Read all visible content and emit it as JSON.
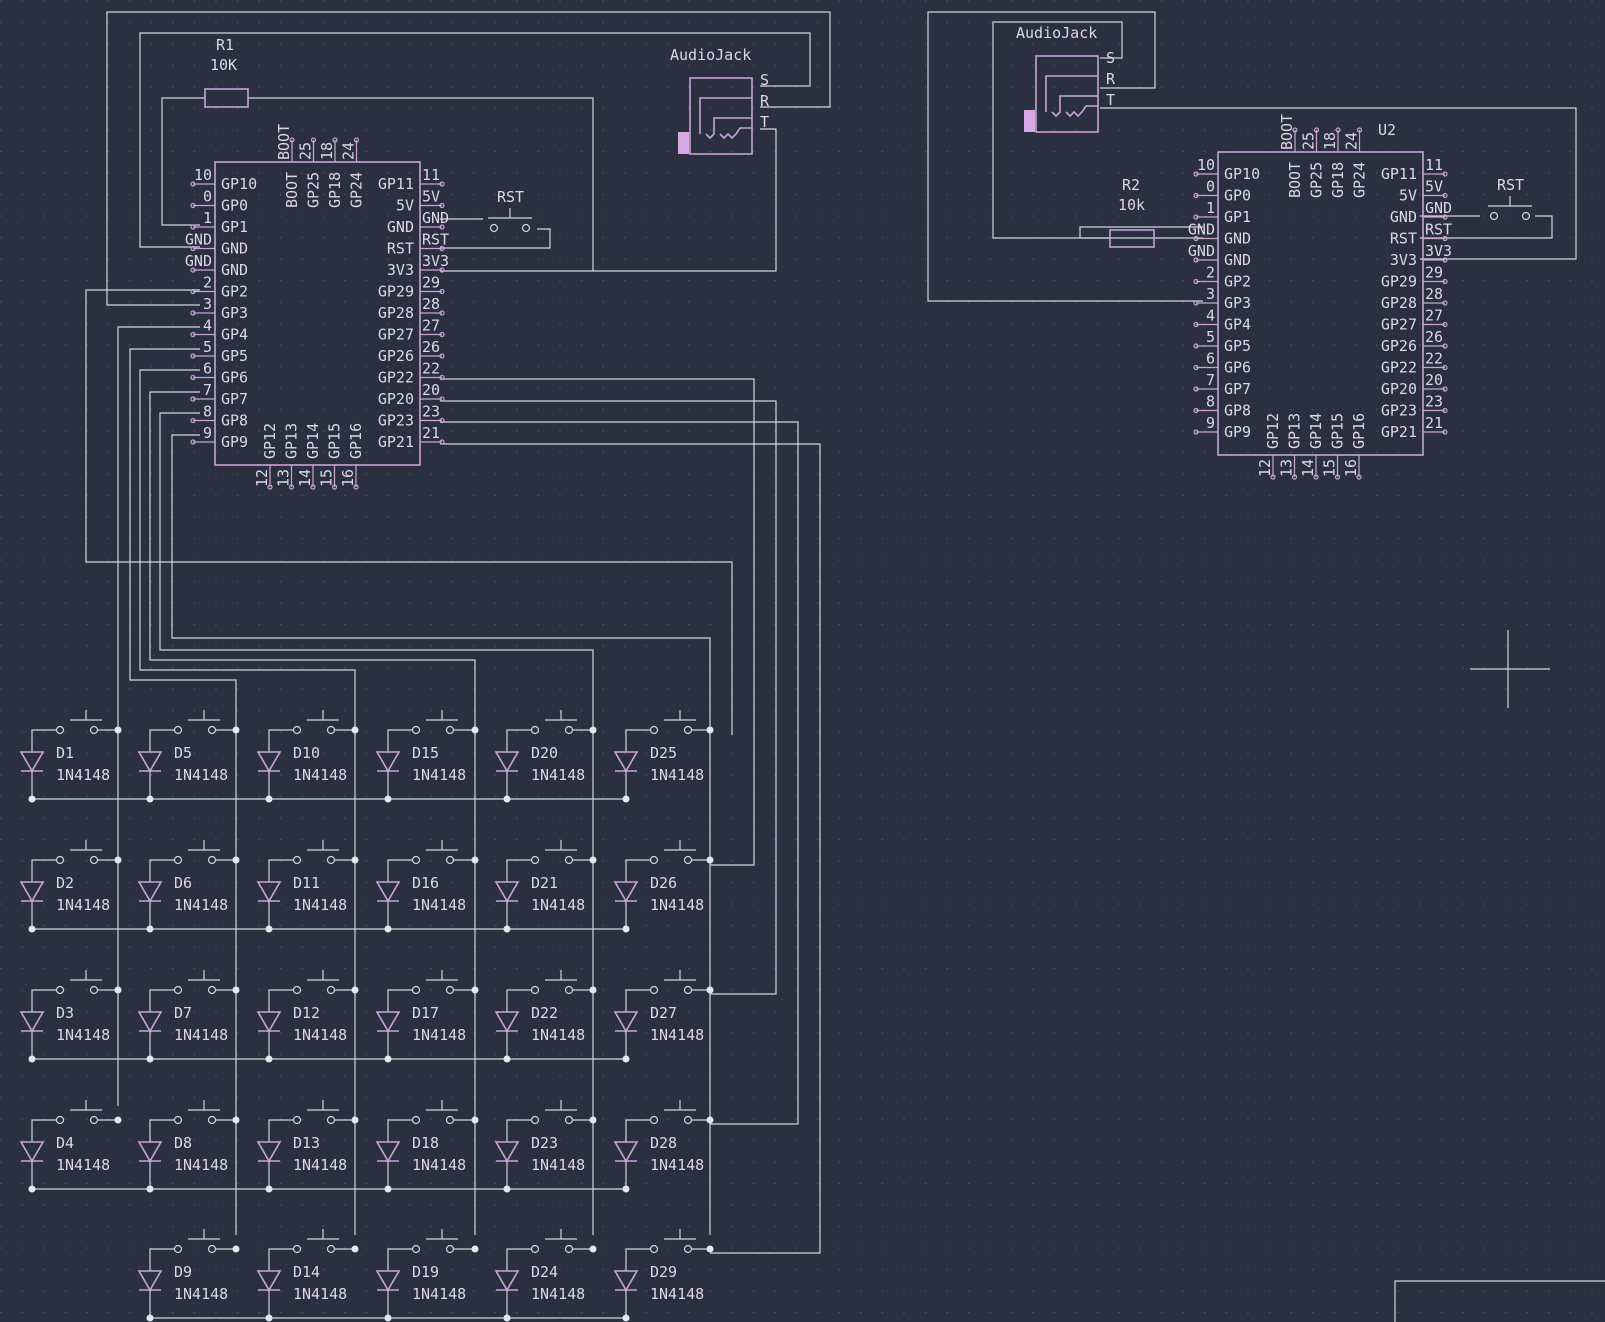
{
  "colors": {
    "background": "#2b3040",
    "wire": "#d2d2dc",
    "symbol": "#c9a4d4",
    "text": "#ddd6e6"
  },
  "r1": {
    "ref": "R1",
    "value": "10K"
  },
  "r2": {
    "ref": "R2",
    "value": "10k"
  },
  "u2": {
    "ref": "U2"
  },
  "audiojack": {
    "name": "AudioJack",
    "pins": [
      "S",
      "R",
      "T"
    ]
  },
  "rst_label": "RST",
  "mcu": {
    "left": [
      [
        "10",
        "GP10"
      ],
      [
        "0",
        "GP0"
      ],
      [
        "1",
        "GP1"
      ],
      [
        "GND",
        "GND"
      ],
      [
        "GND",
        "GND"
      ],
      [
        "2",
        "GP2"
      ],
      [
        "3",
        "GP3"
      ],
      [
        "4",
        "GP4"
      ],
      [
        "5",
        "GP5"
      ],
      [
        "6",
        "GP6"
      ],
      [
        "7",
        "GP7"
      ],
      [
        "8",
        "GP8"
      ],
      [
        "9",
        "GP9"
      ]
    ],
    "right": [
      [
        "11",
        "GP11"
      ],
      [
        "5V",
        "5V"
      ],
      [
        "GND",
        "GND"
      ],
      [
        "RST",
        "RST"
      ],
      [
        "3V3",
        "3V3"
      ],
      [
        "29",
        "GP29"
      ],
      [
        "28",
        "GP28"
      ],
      [
        "27",
        "GP27"
      ],
      [
        "26",
        "GP26"
      ],
      [
        "22",
        "GP22"
      ],
      [
        "20",
        "GP20"
      ],
      [
        "23",
        "GP23"
      ],
      [
        "21",
        "GP21"
      ]
    ],
    "top": [
      [
        "BOOT",
        "BOOT"
      ],
      [
        "25",
        "GP25"
      ],
      [
        "18",
        "GP18"
      ],
      [
        "24",
        "GP24"
      ]
    ],
    "bottom": [
      [
        "12",
        "GP12"
      ],
      [
        "13",
        "GP13"
      ],
      [
        "14",
        "GP14"
      ],
      [
        "15",
        "GP15"
      ],
      [
        "16",
        "GP16"
      ]
    ]
  },
  "diodes": [
    {
      "ref": "D1",
      "value": "1N4148",
      "col": 0,
      "row": 0
    },
    {
      "ref": "D2",
      "value": "1N4148",
      "col": 0,
      "row": 1
    },
    {
      "ref": "D3",
      "value": "1N4148",
      "col": 0,
      "row": 2
    },
    {
      "ref": "D4",
      "value": "1N4148",
      "col": 0,
      "row": 3
    },
    {
      "ref": "D5",
      "value": "1N4148",
      "col": 1,
      "row": 0
    },
    {
      "ref": "D6",
      "value": "1N4148",
      "col": 1,
      "row": 1
    },
    {
      "ref": "D7",
      "value": "1N4148",
      "col": 1,
      "row": 2
    },
    {
      "ref": "D8",
      "value": "1N4148",
      "col": 1,
      "row": 3
    },
    {
      "ref": "D9",
      "value": "1N4148",
      "col": 1,
      "row": 4
    },
    {
      "ref": "D10",
      "value": "1N4148",
      "col": 2,
      "row": 0
    },
    {
      "ref": "D11",
      "value": "1N4148",
      "col": 2,
      "row": 1
    },
    {
      "ref": "D12",
      "value": "1N4148",
      "col": 2,
      "row": 2
    },
    {
      "ref": "D13",
      "value": "1N4148",
      "col": 2,
      "row": 3
    },
    {
      "ref": "D14",
      "value": "1N4148",
      "col": 2,
      "row": 4
    },
    {
      "ref": "D15",
      "value": "1N4148",
      "col": 3,
      "row": 0
    },
    {
      "ref": "D16",
      "value": "1N4148",
      "col": 3,
      "row": 1
    },
    {
      "ref": "D17",
      "value": "1N4148",
      "col": 3,
      "row": 2
    },
    {
      "ref": "D18",
      "value": "1N4148",
      "col": 3,
      "row": 3
    },
    {
      "ref": "D19",
      "value": "1N4148",
      "col": 3,
      "row": 4
    },
    {
      "ref": "D20",
      "value": "1N4148",
      "col": 4,
      "row": 0
    },
    {
      "ref": "D21",
      "value": "1N4148",
      "col": 4,
      "row": 1
    },
    {
      "ref": "D22",
      "value": "1N4148",
      "col": 4,
      "row": 2
    },
    {
      "ref": "D23",
      "value": "1N4148",
      "col": 4,
      "row": 3
    },
    {
      "ref": "D24",
      "value": "1N4148",
      "col": 4,
      "row": 4
    },
    {
      "ref": "D25",
      "value": "1N4148",
      "col": 5,
      "row": 0
    },
    {
      "ref": "D26",
      "value": "1N4148",
      "col": 5,
      "row": 1
    },
    {
      "ref": "D27",
      "value": "1N4148",
      "col": 5,
      "row": 2
    },
    {
      "ref": "D28",
      "value": "1N4148",
      "col": 5,
      "row": 3
    },
    {
      "ref": "D29",
      "value": "1N4148",
      "col": 5,
      "row": 4
    }
  ]
}
